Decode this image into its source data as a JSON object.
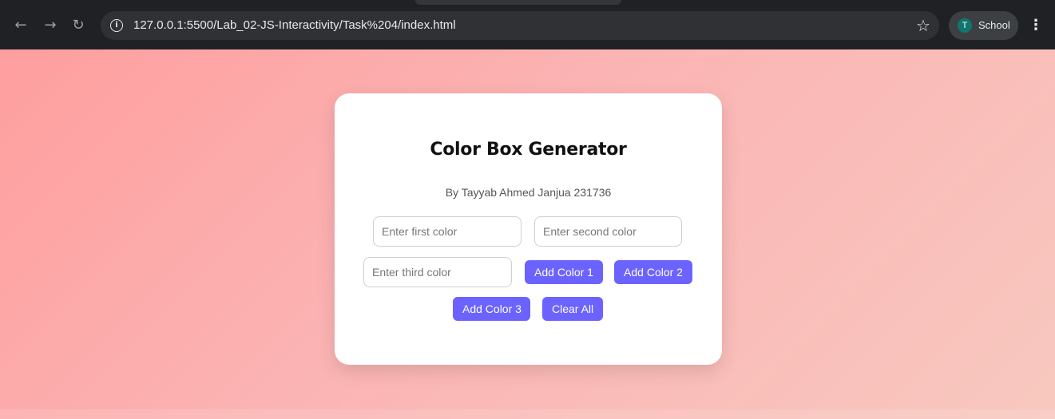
{
  "browser": {
    "url": "127.0.0.1:5500/Lab_02-JS-Interactivity/Task%204/index.html",
    "profile_initial": "T",
    "profile_name": "School",
    "icons": {
      "back": "arrow-left-icon",
      "forward": "arrow-right-icon",
      "reload": "reload-icon",
      "info": "info-icon",
      "bookmark": "star-icon",
      "menu": "kebab-menu-icon"
    }
  },
  "card": {
    "title": "Color Box Generator",
    "subtitle": "By Tayyab Ahmed Janjua 231736"
  },
  "inputs": {
    "first_placeholder": "Enter first color",
    "second_placeholder": "Enter second color",
    "third_placeholder": "Enter third color",
    "first_value": "",
    "second_value": "",
    "third_value": ""
  },
  "buttons": {
    "add_color_1": "Add Color 1",
    "add_color_2": "Add Color 2",
    "add_color_3": "Add Color 3",
    "clear_all": "Clear All"
  },
  "colors": {
    "accent": "#6c63ff",
    "page_gradient_start": "#ff9e9e",
    "page_gradient_end": "#f8c8bf",
    "card_bg": "#ffffff",
    "browser_chrome": "#202124"
  }
}
